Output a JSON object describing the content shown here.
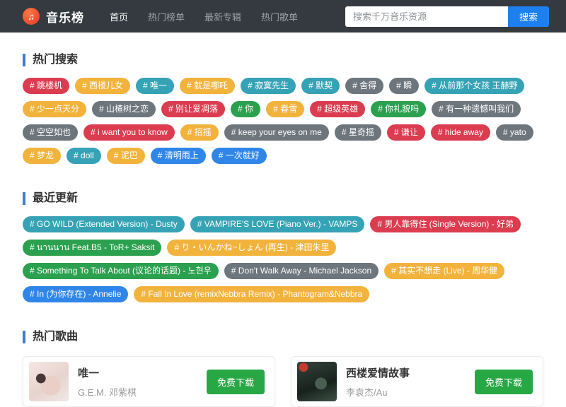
{
  "colors": {
    "red": "#dc3c50",
    "yellow": "#f2b33d",
    "teal": "#35a3b5",
    "gray": "#6e767d",
    "green": "#2ba14f",
    "blue": "#2f86e8",
    "accent_blue": "#3d7fc4",
    "search_button_blue": "#1e80f0",
    "download_green": "#28a745",
    "brand_orange": "#f25030",
    "navbar_dark": "#343a40"
  },
  "navbar": {
    "brand": "音乐榜",
    "logo_icon": "music-note",
    "items": [
      {
        "label": "首页",
        "active": true
      },
      {
        "label": "热门榜单",
        "active": false
      },
      {
        "label": "最新专辑",
        "active": false
      },
      {
        "label": "热门歌单",
        "active": false
      }
    ],
    "search": {
      "placeholder": "搜索千万音乐资源",
      "button": "搜索"
    }
  },
  "sections": {
    "hot_search": {
      "title": "热门搜索",
      "tags": [
        {
          "label": "# 跳楼机",
          "color": "red"
        },
        {
          "label": "# 西楼儿女",
          "color": "yellow"
        },
        {
          "label": "# 唯一",
          "color": "teal"
        },
        {
          "label": "# 就是哪吒",
          "color": "yellow"
        },
        {
          "label": "# 寂寞先生",
          "color": "teal"
        },
        {
          "label": "# 默契",
          "color": "teal"
        },
        {
          "label": "# 舍得",
          "color": "gray"
        },
        {
          "label": "# 瞬",
          "color": "gray"
        },
        {
          "label": "# 从前那个女孩 王赫野",
          "color": "teal"
        },
        {
          "label": "# 少一点天分",
          "color": "yellow"
        },
        {
          "label": "# 山楂树之恋",
          "color": "gray"
        },
        {
          "label": "# 别让爱凋落",
          "color": "red"
        },
        {
          "label": "# 你",
          "color": "green"
        },
        {
          "label": "# 春雪",
          "color": "yellow"
        },
        {
          "label": "# 超级英雄",
          "color": "red"
        },
        {
          "label": "# 你礼貌吗",
          "color": "green"
        },
        {
          "label": "# 有一种遗憾叫我们",
          "color": "gray"
        },
        {
          "label": "# 空空如也",
          "color": "gray"
        },
        {
          "label": "# i want you to know",
          "color": "red"
        },
        {
          "label": "# 招摇",
          "color": "yellow"
        },
        {
          "label": "# keep your eyes on me",
          "color": "gray"
        },
        {
          "label": "# 星奇摇",
          "color": "gray"
        },
        {
          "label": "# 谦让",
          "color": "red"
        },
        {
          "label": "# hide away",
          "color": "red"
        },
        {
          "label": "# yato",
          "color": "gray"
        },
        {
          "label": "# 梦龙",
          "color": "yellow"
        },
        {
          "label": "# doll",
          "color": "teal"
        },
        {
          "label": "# 泥巴",
          "color": "yellow"
        },
        {
          "label": "# 清明雨上",
          "color": "blue"
        },
        {
          "label": "# 一次就好",
          "color": "blue"
        }
      ]
    },
    "recent_updates": {
      "title": "最近更新",
      "tags": [
        {
          "label": "# GO WILD (Extended Version) - Dusty",
          "color": "teal"
        },
        {
          "label": "# VAMPIRE'S LOVE (Piano Ver.) - VAMPS",
          "color": "teal"
        },
        {
          "label": "# 男人靠得住 (Single Version) - 好弟",
          "color": "red"
        },
        {
          "label": "# นานนาน Feat.B5 - ToR+ Saksit",
          "color": "green"
        },
        {
          "label": "# り・いんかね~しょん (再生) - 津田朱里",
          "color": "yellow"
        },
        {
          "label": "# Something To Talk About (议论的话题) - 노현우",
          "color": "green"
        },
        {
          "label": "# Don't Walk Away - Michael Jackson",
          "color": "gray"
        },
        {
          "label": "# 其实不想走 (Live) - 周华健",
          "color": "yellow"
        },
        {
          "label": "# In (为你存在) - Annelie",
          "color": "blue"
        },
        {
          "label": "# Fall In Love (remixNebbra Remix) - Phantogram&Nebbra",
          "color": "yellow"
        }
      ]
    },
    "hot_songs": {
      "title": "热门歌曲",
      "download_label": "免费下载",
      "cards": [
        {
          "title": "唯一",
          "artist": "G.E.M. 邓紫棋",
          "button": "免费下载"
        },
        {
          "title": "西楼爱情故事",
          "artist": "李袁杰/Au",
          "button": "免费下载"
        }
      ]
    }
  }
}
